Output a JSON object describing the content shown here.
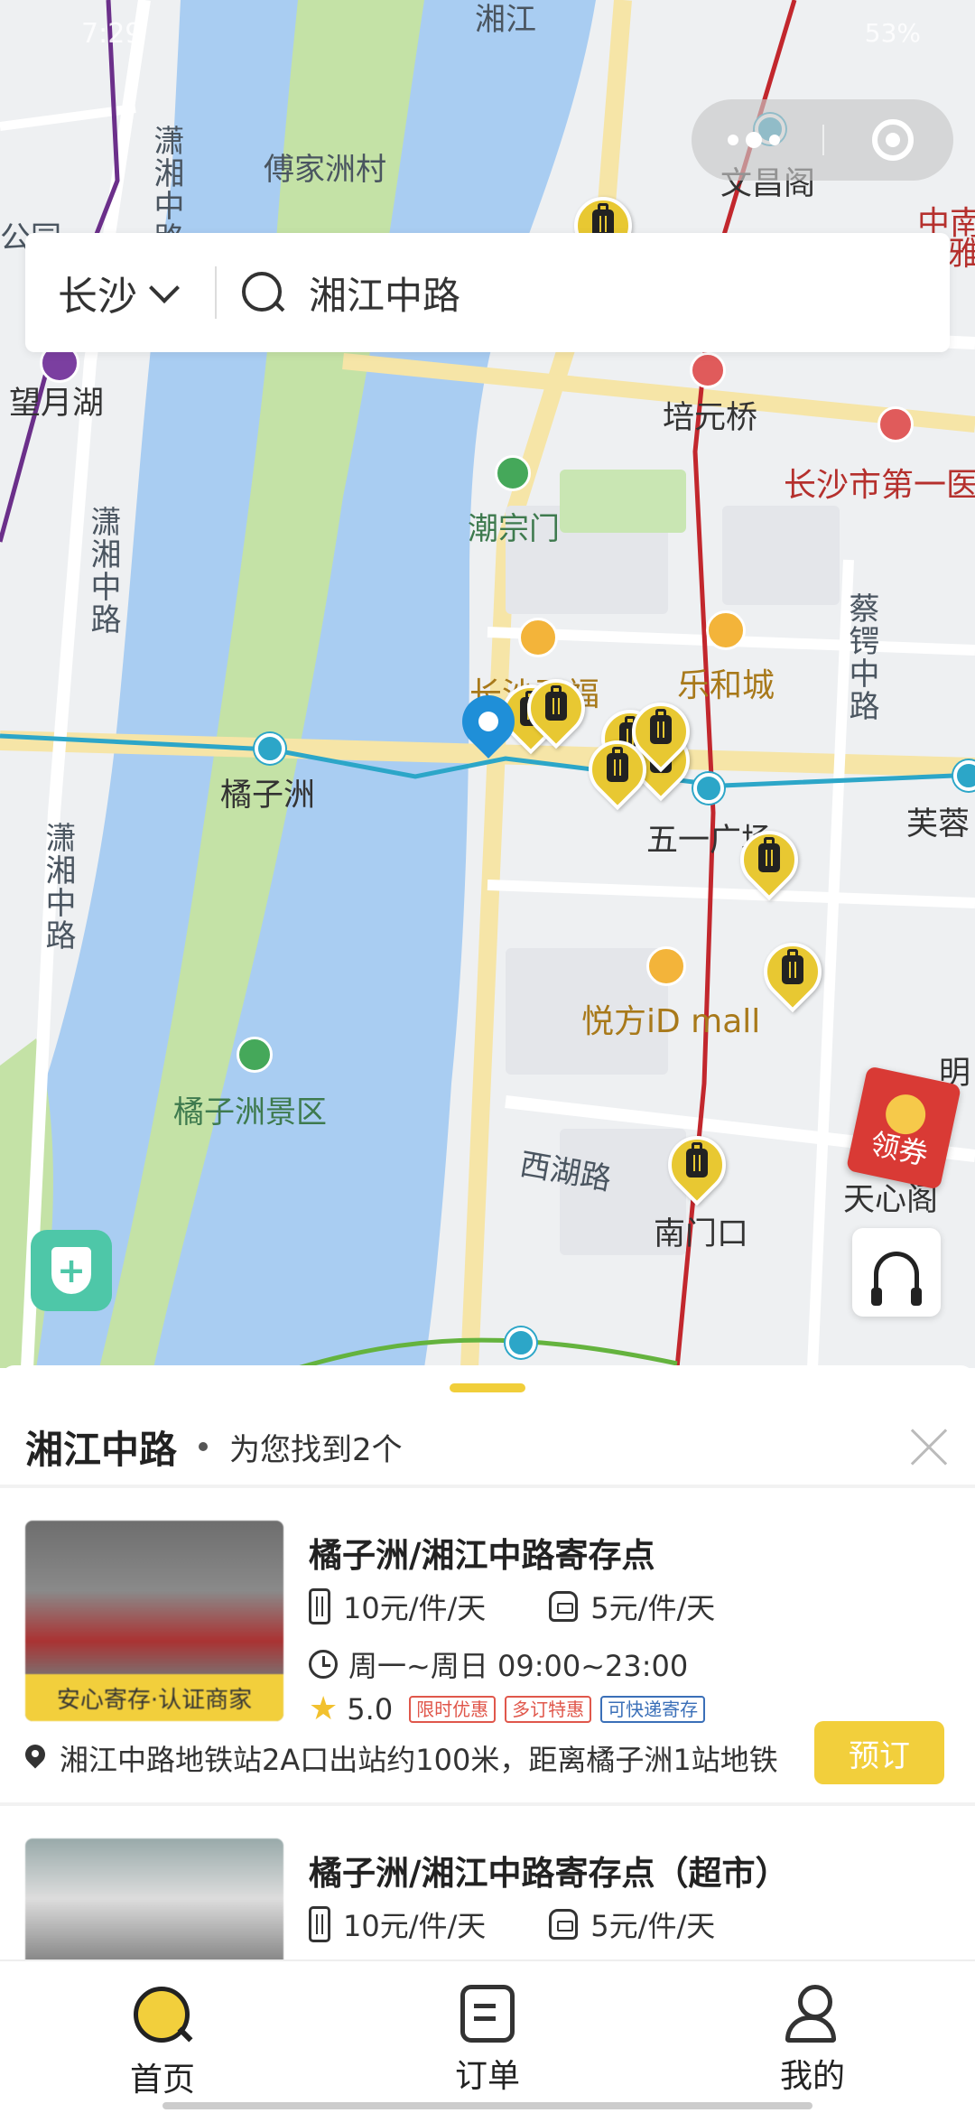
{
  "status": {
    "time": "7:29",
    "battery": "53%"
  },
  "search": {
    "city": "长沙",
    "query": "湘江中路"
  },
  "map_labels": {
    "fujia": "傅家洲村",
    "wenchang": "文昌阁",
    "zhongnan": "中南",
    "ya": "雅",
    "gongyuan": "公园",
    "wangyuehu": "望月湖",
    "xiaoxiang1": "潇湘中路",
    "xiaoxiang2": "潇湘中路",
    "xiaoxiang3": "潇湘中路",
    "peiyuanqiao": "培元桥",
    "hospital": "长沙市第一医",
    "chaozongmen": "潮宗门",
    "caie": "蔡锷中路",
    "kaifu": "长沙开福",
    "lehecheng": "乐和城",
    "juzizhou": "橘子洲",
    "wuyi": "五一广场",
    "furong": "芙蓉",
    "yuefang": "悦方iD mall",
    "jingqu": "橘子洲景区",
    "xihulu": "西湖路",
    "nanmenkou": "南门口",
    "tianxinge": "天心阁",
    "ming": "明",
    "xiangjiang_top": "湘江"
  },
  "coupon": {
    "label": "领券"
  },
  "panel": {
    "title": "湘江中路",
    "subtitle": "为您找到2个"
  },
  "listings": [
    {
      "name": "橘子洲/湘江中路寄存点",
      "price_luggage": "10元/件/天",
      "price_bag": "5元/件/天",
      "hours": "周一~周日 09:00~23:00",
      "rating": "5.0",
      "badge": "安心寄存·认证商家",
      "tags": [
        "限时优惠",
        "多订特惠",
        "可快递寄存"
      ],
      "address": "湘江中路地铁站2A口出站约100米，距离橘子洲1站地铁",
      "book_label": "预订"
    },
    {
      "name": "橘子洲/湘江中路寄存点（超市）",
      "price_luggage": "10元/件/天",
      "price_bag": "5元/件/天"
    }
  ],
  "tabs": [
    {
      "label": "首页",
      "icon": "search-home-icon",
      "active": true
    },
    {
      "label": "订单",
      "icon": "order-icon",
      "active": false
    },
    {
      "label": "我的",
      "icon": "profile-icon",
      "active": false
    }
  ],
  "colors": {
    "accent": "#f2cf3c",
    "river": "#a9cdf2",
    "island": "#c4e2a6",
    "metro_red": "#c2272d",
    "metro_blue": "#2ca6c8"
  }
}
